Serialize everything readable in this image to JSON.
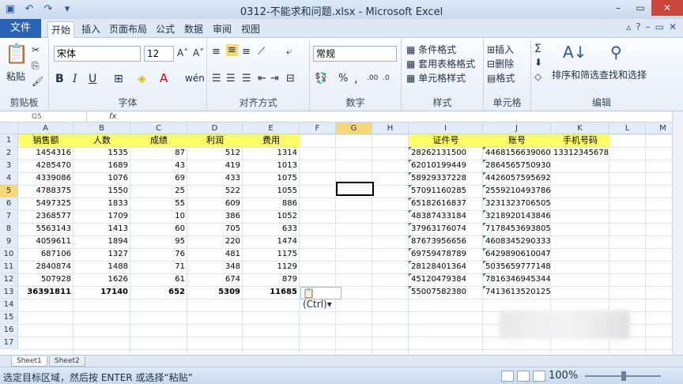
{
  "window": {
    "title": "0312-不能求和问题.xlsx - Microsoft Excel"
  },
  "tabs": [
    "开始",
    "插入",
    "页面布局",
    "公式",
    "数据",
    "审阅",
    "视图"
  ],
  "file_tab": "文件",
  "ribbon": {
    "clipboard": {
      "paste": "粘贴",
      "label": "剪贴板"
    },
    "font": {
      "name": "宋体",
      "size": "12",
      "label": "字体",
      "bold": "B",
      "italic": "I",
      "underline": "U"
    },
    "alignment": {
      "label": "对齐方式"
    },
    "number": {
      "format": "常规",
      "label": "数字",
      "percent": "%",
      "comma": ","
    },
    "styles": {
      "cond": "条件格式",
      "table": "套用表格格式",
      "cell": "单元格样式",
      "label": "样式"
    },
    "cells": {
      "insert": "插入",
      "delete": "删除",
      "format": "格式",
      "label": "单元格"
    },
    "editing": {
      "sort": "排序和筛选",
      "find": "查找和选择",
      "label": "编辑"
    }
  },
  "namebox": "G5",
  "fx": "fx",
  "columns": [
    "A",
    "B",
    "C",
    "D",
    "E",
    "F",
    "G",
    "H",
    "I",
    "J",
    "K",
    "L",
    "M"
  ],
  "rows": [
    "1",
    "2",
    "3",
    "4",
    "5",
    "6",
    "7",
    "8",
    "9",
    "10",
    "11",
    "12",
    "13",
    "14",
    "15",
    "16",
    "17"
  ],
  "headers": {
    "A": "销售额",
    "B": "人数",
    "C": "成绩",
    "D": "利润",
    "E": "费用",
    "I": "证件号",
    "J": "账号",
    "K": "手机号码"
  },
  "data": [
    [
      "1454316",
      "1535",
      "87",
      "512",
      "1314"
    ],
    [
      "4285470",
      "1689",
      "43",
      "419",
      "1013"
    ],
    [
      "4339086",
      "1076",
      "69",
      "433",
      "1075"
    ],
    [
      "4788375",
      "1550",
      "25",
      "522",
      "1055"
    ],
    [
      "5497325",
      "1833",
      "55",
      "609",
      "886"
    ],
    [
      "2368577",
      "1709",
      "10",
      "386",
      "1052"
    ],
    [
      "5563143",
      "1413",
      "60",
      "705",
      "633"
    ],
    [
      "4059611",
      "1894",
      "95",
      "220",
      "1474"
    ],
    [
      "687106",
      "1327",
      "76",
      "481",
      "1175"
    ],
    [
      "2840874",
      "1488",
      "71",
      "348",
      "1129"
    ],
    [
      "507928",
      "1626",
      "61",
      "674",
      "879"
    ],
    [
      "36391811",
      "17140",
      "652",
      "5309",
      "11685"
    ]
  ],
  "ids": [
    "28262131500",
    "62010199449",
    "58929337228",
    "57091160285",
    "65182616837",
    "48387433184",
    "37963176074",
    "87673956656",
    "69759478789",
    "28128401364",
    "45120479384",
    "55007582380"
  ],
  "accounts": [
    "4468156639060",
    "2864565750930",
    "4426057595692",
    "2559210493786",
    "3231323706505",
    "3218920143846",
    "7178453693805",
    "4608345290333",
    "6429890610047",
    "5035659777148",
    "7816346945344",
    "7413613520125"
  ],
  "phone": "13312345678",
  "paste_options": "(Ctrl)",
  "sheets": [
    "Sheet1",
    "Sheet2"
  ],
  "status": {
    "message": "选定目标区域，然后按 ENTER 或选择“粘贴”",
    "zoom": "100%"
  }
}
